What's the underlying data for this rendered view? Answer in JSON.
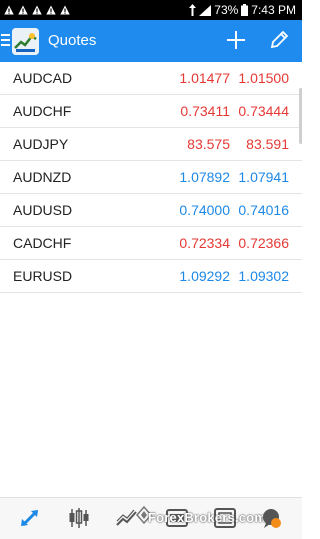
{
  "status_bar": {
    "battery": "73%",
    "time": "7:43 PM",
    "notification_icons": [
      "warning-icon",
      "warning-icon",
      "warning-icon",
      "warning-icon",
      "warning-icon"
    ]
  },
  "app_bar": {
    "title": "Quotes",
    "color": "#1f8bef"
  },
  "quotes": [
    {
      "symbol": "AUDCAD",
      "bid": "1.01477",
      "ask": "1.01500",
      "direction": "down"
    },
    {
      "symbol": "AUDCHF",
      "bid": "0.73411",
      "ask": "0.73444",
      "direction": "down"
    },
    {
      "symbol": "AUDJPY",
      "bid": "83.575",
      "ask": "83.591",
      "direction": "down"
    },
    {
      "symbol": "AUDNZD",
      "bid": "1.07892",
      "ask": "1.07941",
      "direction": "up"
    },
    {
      "symbol": "AUDUSD",
      "bid": "0.74000",
      "ask": "0.74016",
      "direction": "up"
    },
    {
      "symbol": "CADCHF",
      "bid": "0.72334",
      "ask": "0.72366",
      "direction": "down"
    },
    {
      "symbol": "EURUSD",
      "bid": "1.09292",
      "ask": "1.09302",
      "direction": "up"
    }
  ],
  "colors": {
    "down": "#e53935",
    "up": "#1e88e5"
  },
  "bottom_nav": {
    "items": [
      "quotes-icon",
      "chart-icon",
      "trade-icon",
      "history-icon",
      "messages-icon",
      "chat-icon"
    ],
    "watermark": "ForexBrokers.com"
  }
}
